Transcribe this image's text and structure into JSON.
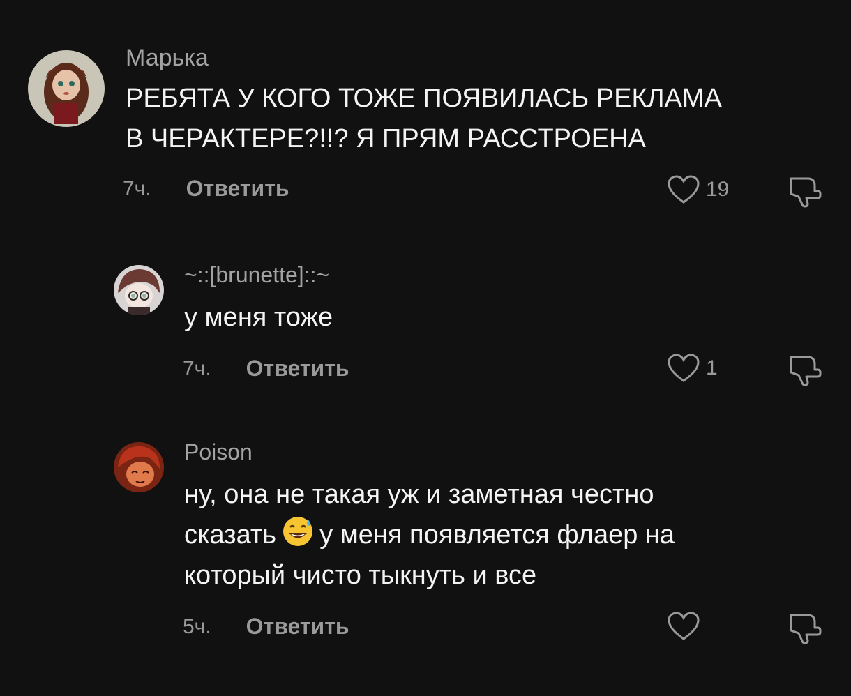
{
  "comments": [
    {
      "username": "Марька",
      "text_line1": "РЕБЯТА У КОГО ТОЖЕ ПОЯВИЛАСЬ РЕКЛАМА",
      "text_line2": "В ЧЕРАКТЕРЕ?!!? Я ПРЯМ РАССТРОЕНА",
      "time": "7ч.",
      "reply_label": "Ответить",
      "likes": "19"
    },
    {
      "username": "~::[brunette]::~",
      "text": "у меня тоже",
      "time": "7ч.",
      "reply_label": "Ответить",
      "likes": "1"
    },
    {
      "username": "Poison",
      "text_line1": "ну, она не такая уж и заметная честно",
      "text_line2a": "сказать",
      "text_line2b": "у меня появляется флаер на",
      "text_line3": "который чисто тыкнуть и все",
      "emoji": "grinning-face-with-sweat-icon",
      "time": "5ч.",
      "reply_label": "Ответить",
      "likes": ""
    }
  ],
  "colors": {
    "background": "#111112",
    "username": "#a3a3a3",
    "text": "#f4f4f4",
    "meta": "#9a9a9a"
  }
}
